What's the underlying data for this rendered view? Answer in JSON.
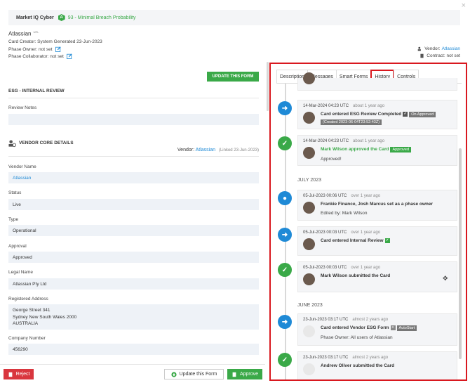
{
  "window": {
    "close_glyph": "×"
  },
  "banner": {
    "category": "Market IQ Cyber",
    "grade": "A",
    "score_text": "93 - Minimal Breach Probability"
  },
  "card": {
    "vendor_name": "Atlassian",
    "url_tag": "URL",
    "creator": "Card Creator: System Generated 23-Jun-2023",
    "phase_owner": "Phase Owner: not set",
    "phase_collaborator": "Phase Collaborator: not set",
    "vendor_label": "Vendor:",
    "vendor_link": "Atlassian",
    "contract": "Contract: not set"
  },
  "left": {
    "update_button": "UPDATE THIS FORM",
    "esg_title": "ESG - INTERNAL REVIEW",
    "review_notes_label": "Review Notes",
    "review_notes_value": "",
    "vendor_core_title": "VENDOR CORE DETAILS",
    "vendor_line_label": "Vendor:",
    "vendor_line_link": "Atlassian",
    "vendor_line_linked": "(Linked 23-Jun-2023)",
    "fields": [
      {
        "label": "Vendor Name",
        "value": "Atlassian"
      },
      {
        "label": "Status",
        "value": "Live"
      },
      {
        "label": "Type",
        "value": "Operational"
      },
      {
        "label": "Approval",
        "value": "Approved"
      },
      {
        "label": "Legal Name",
        "value": "Atlassian Pty Ltd"
      },
      {
        "label": "Registered Address",
        "value_line1": "George Street 341",
        "value_line2": "Sydney New South Wales 2000",
        "value_line3": "AUSTRALIA"
      },
      {
        "label": "Company Number",
        "value": "456290"
      }
    ]
  },
  "bottom": {
    "reject": "Reject",
    "update": "Update this Form",
    "approve": "Approve"
  },
  "tabs": [
    "Description",
    "Messages",
    "Smart Forms",
    "History",
    "Controls"
  ],
  "history": {
    "entries": [
      {
        "time": "14-Mar-2024 04:23 UTC",
        "ago": "about 1 year ago",
        "text": "Card entered ESG Review Completed",
        "tag": "On Approved",
        "sub": "(Created 2023-06-04T23:52:43Z)"
      },
      {
        "time": "14-Mar-2024 04:23 UTC",
        "ago": "about 1 year ago",
        "text": "Mark Wilson approved the Card",
        "tag": "Approved",
        "sub": "Approved!"
      },
      {
        "time": "05-Jul-2023 00:06 UTC",
        "ago": "over 1 year ago",
        "text": "Frankie Finance, Josh Marcus set as a phase owner",
        "sub": "Edited by: Mark Wilson"
      },
      {
        "time": "05-Jul-2023 00:03 UTC",
        "ago": "over 1 year ago",
        "text": "Card entered Internal Review"
      },
      {
        "time": "05-Jul-2023 00:03 UTC",
        "ago": "over 1 year ago",
        "text": "Mark Wilson submitted the Card"
      },
      {
        "time": "23-Jun-2023 03:17 UTC",
        "ago": "almost 2 years ago",
        "text": "Card entered Vendor ESG Form",
        "tag": "AutoStart",
        "sub": "Phase Owner: All users of Atlassian"
      },
      {
        "time": "23-Jun-2023 03:17 UTC",
        "ago": "almost 2 years ago",
        "text": "Andrew Oliver submitted the Card"
      }
    ],
    "months": [
      "JULY 2023",
      "JUNE 2023"
    ]
  },
  "colors": {
    "accent_green": "#3aa948",
    "accent_blue": "#1f8ad6",
    "highlight_red": "#d9181f"
  }
}
